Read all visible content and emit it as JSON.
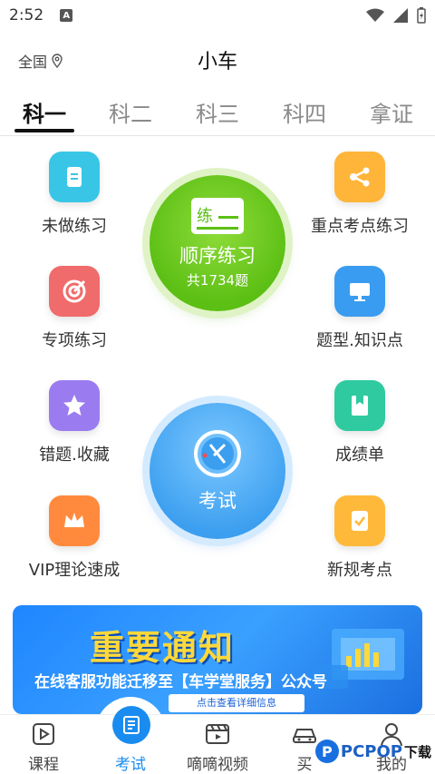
{
  "status_bar": {
    "time": "2:52",
    "a_badge": "A"
  },
  "header": {
    "region": "全国",
    "title": "小车"
  },
  "tabs": [
    {
      "label": "科一",
      "active": true
    },
    {
      "label": "科二"
    },
    {
      "label": "科三"
    },
    {
      "label": "科四"
    },
    {
      "label": "拿证"
    }
  ],
  "left_items": [
    {
      "label": "未做练习",
      "icon": "document-icon",
      "color": "#39c6e6"
    },
    {
      "label": "专项练习",
      "icon": "target-icon",
      "color": "#f06b6b"
    },
    {
      "label": "错题.收藏",
      "icon": "star-icon",
      "color": "#9a7cf0"
    },
    {
      "label": "VIP理论速成",
      "icon": "crown-icon",
      "color": "#ff8a3d"
    }
  ],
  "right_items": [
    {
      "label": "重点考点练习",
      "icon": "share-nodes-icon",
      "color": "#ffb53a"
    },
    {
      "label": "题型.知识点",
      "icon": "monitor-icon",
      "color": "#3a9cf0"
    },
    {
      "label": "成绩单",
      "icon": "bookmark-icon",
      "color": "#2fcaa0"
    },
    {
      "label": "新规考点",
      "icon": "checklist-icon",
      "color": "#ffb93a"
    }
  ],
  "sequence_practice": {
    "icon_text": "练",
    "label": "顺序练习",
    "count": "共1734题"
  },
  "exam": {
    "label": "考试"
  },
  "banner": {
    "title": "重要通知",
    "subtitle": "在线客服功能迁移至【车学堂服务】公众号",
    "button": "点击查看详细信息"
  },
  "bottom_nav": [
    {
      "label": "课程",
      "icon": "play-icon"
    },
    {
      "label": "考试",
      "icon": "exam-icon",
      "active": true
    },
    {
      "label": "嘀嘀视频",
      "icon": "video-icon"
    },
    {
      "label": "买",
      "icon": "car-icon"
    },
    {
      "label": "我的",
      "icon": "user-icon"
    }
  ],
  "watermark": {
    "text": "PCPOP",
    "text2": "下载"
  },
  "colors": {
    "accent_blue": "#1a8cf0",
    "green": "#5cbf14"
  }
}
